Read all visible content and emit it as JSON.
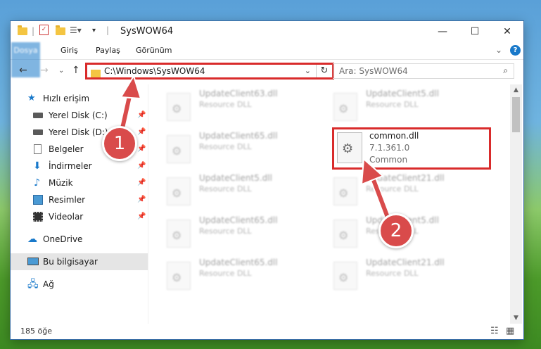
{
  "window": {
    "title": "SysWOW64",
    "controls": {
      "minimize": "—",
      "maximize": "☐",
      "close": "✕"
    }
  },
  "ribbon": {
    "tabs": [
      "Dosya",
      "Giriş",
      "Paylaş",
      "Görünüm"
    ],
    "expand_glyph": "⌄",
    "help_glyph": "?"
  },
  "nav": {
    "back": "←",
    "forward": "→",
    "recent": "⌄",
    "up": "↑",
    "address_path": "C:\\Windows\\SysWOW64",
    "address_dropdown": "⌄",
    "refresh": "↻",
    "search_placeholder": "Ara: SysWOW64",
    "search_icon": "⌕"
  },
  "sidebar": {
    "items": [
      {
        "label": "Hızlı erişim",
        "icon": "star-icon",
        "pinned": false
      },
      {
        "label": "Yerel Disk (C:)",
        "icon": "drive-icon",
        "pinned": true
      },
      {
        "label": "Yerel Disk (D:)",
        "icon": "drive-icon",
        "pinned": true
      },
      {
        "label": "Belgeler",
        "icon": "documents-icon",
        "pinned": true
      },
      {
        "label": "İndirmeler",
        "icon": "download-icon",
        "pinned": true
      },
      {
        "label": "Müzik",
        "icon": "music-icon",
        "pinned": true
      },
      {
        "label": "Resimler",
        "icon": "pictures-icon",
        "pinned": true
      },
      {
        "label": "Videolar",
        "icon": "video-icon",
        "pinned": true
      },
      {
        "label": "OneDrive",
        "icon": "cloud-icon",
        "pinned": false
      },
      {
        "label": "Bu bilgisayar",
        "icon": "computer-icon",
        "pinned": false,
        "selected": true
      },
      {
        "label": "Ağ",
        "icon": "network-icon",
        "pinned": false
      }
    ],
    "pin_glyph": "📌"
  },
  "files": [
    {
      "name": "UpdateClient63.dll",
      "desc": "Resource DLL"
    },
    {
      "name": "UpdateClient5.dll",
      "desc": "Resource DLL"
    },
    {
      "name": "UpdateClient65.dll",
      "desc": "Resource DLL"
    },
    {
      "name": "UpdateClient5.dll",
      "desc": "Resource DLL"
    },
    {
      "name": "UpdateClient21.dll",
      "desc": "Resource DLL"
    },
    {
      "name": "UpdateClient65.dll",
      "desc": "Resource DLL"
    },
    {
      "name": "UpdateClient5.dll",
      "desc": "Resource DLL"
    },
    {
      "name": "UpdateClient65.dll",
      "desc": "Resource DLL"
    },
    {
      "name": "UpdateClient21.dll",
      "desc": "Resource DLL"
    }
  ],
  "highlighted_file": {
    "name": "common.dll",
    "version": "7.1.361.0",
    "desc": "Common"
  },
  "status": {
    "item_count": "185 öğe"
  },
  "annotations": {
    "step1": "1",
    "step2": "2"
  },
  "colors": {
    "accent": "#1979ca",
    "highlight": "#d92b2b",
    "badge": "#d94b4b"
  }
}
